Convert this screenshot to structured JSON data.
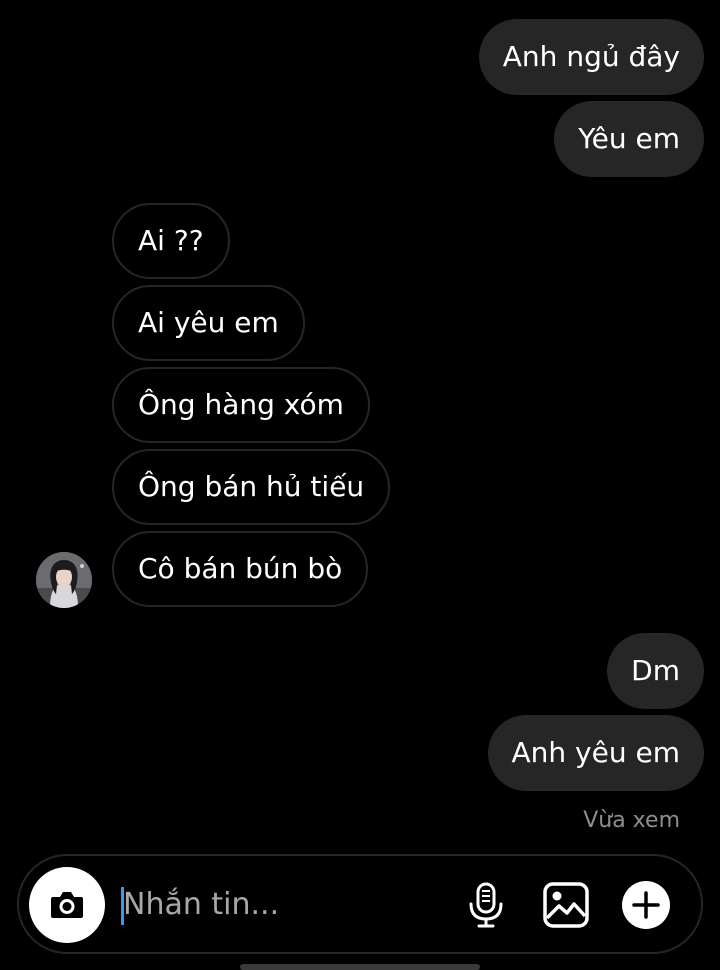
{
  "conversation": {
    "messages": [
      {
        "direction": "sent",
        "text": "Anh ngủ đây"
      },
      {
        "direction": "sent",
        "text": "Yêu em"
      },
      {
        "direction": "received",
        "text": "Ai ??"
      },
      {
        "direction": "received",
        "text": "Ai yêu em"
      },
      {
        "direction": "received",
        "text": "Ông hàng xóm"
      },
      {
        "direction": "received",
        "text": "Ông bán hủ tiếu"
      },
      {
        "direction": "received",
        "text": "Cô bán bún bò"
      },
      {
        "direction": "sent",
        "text": "Dm"
      },
      {
        "direction": "sent",
        "text": "Anh yêu em"
      }
    ],
    "seen_status": "Vừa xem"
  },
  "composer": {
    "placeholder": "Nhắn tin...",
    "icons": {
      "camera": "camera-icon",
      "microphone": "microphone-icon",
      "gallery": "image-gallery-icon",
      "more": "plus-circle-icon"
    }
  },
  "colors": {
    "background": "#000000",
    "sent_bubble": "#262626",
    "received_border": "#262626",
    "text": "#ffffff",
    "muted_text": "#8e8e8e",
    "cursor": "#3897f0"
  }
}
